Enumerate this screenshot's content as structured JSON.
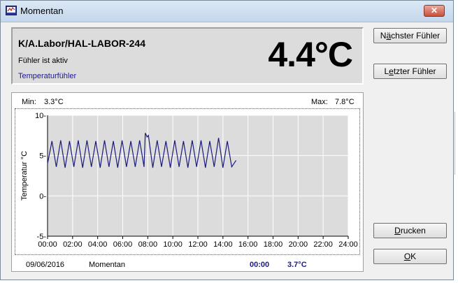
{
  "window": {
    "title": "Momentan",
    "close_glyph": "✕",
    "app_icon": "monitor-icon",
    "close_icon": "close-icon"
  },
  "header": {
    "sensor_name": "K/A.Labor/HAL-LABOR-244",
    "status": "Fühler ist aktiv",
    "type": "Temperaturfühler",
    "current_value": "4.4°C"
  },
  "buttons": {
    "next": {
      "pre": "N",
      "ul": "ä",
      "post": "chster Fühler"
    },
    "last": {
      "pre": "L",
      "ul": "e",
      "post": "tzter Fühler"
    },
    "print": {
      "pre": "",
      "ul": "D",
      "post": "rucken"
    },
    "ok": {
      "pre": "",
      "ul": "O",
      "post": "K"
    }
  },
  "minmax": {
    "min_label": "Min:",
    "min_value": "3.3°C",
    "max_label": "Max:",
    "max_value": "7.8°C"
  },
  "footer": {
    "date": "09/06/2016",
    "mode": "Momentan",
    "time": "00:00",
    "value": "3.7°C"
  },
  "chart_data": {
    "type": "line",
    "title": "",
    "xlabel": "",
    "ylabel": "Temperatur °C",
    "xlim": [
      0,
      24
    ],
    "ylim": [
      -5,
      10
    ],
    "x_ticks": [
      "00:00",
      "02:00",
      "04:00",
      "06:00",
      "08:00",
      "10:00",
      "12:00",
      "14:00",
      "16:00",
      "18:00",
      "20:00",
      "22:00",
      "24:00"
    ],
    "y_ticks": [
      "10-",
      "5-",
      "0-",
      "-5-"
    ],
    "y_tick_values": [
      10,
      5,
      0,
      -5
    ],
    "grid": true,
    "series": [
      {
        "color": "#1a1a7a",
        "x": [
          0.0,
          0.35,
          0.7,
          1.05,
          1.4,
          1.75,
          2.1,
          2.45,
          2.8,
          3.15,
          3.5,
          3.85,
          4.2,
          4.55,
          4.9,
          5.25,
          5.6,
          5.95,
          6.3,
          6.65,
          7.0,
          7.35,
          7.7,
          7.8,
          7.95,
          8.05,
          8.4,
          8.75,
          9.1,
          9.45,
          9.8,
          10.15,
          10.5,
          10.85,
          11.2,
          11.55,
          11.9,
          12.25,
          12.6,
          12.95,
          13.3,
          13.65,
          14.0,
          14.35,
          14.7,
          15.05
        ],
        "y": [
          4.0,
          6.8,
          3.6,
          6.9,
          3.5,
          6.8,
          3.6,
          6.9,
          3.5,
          6.9,
          3.6,
          6.8,
          3.5,
          6.9,
          3.6,
          6.8,
          3.5,
          6.9,
          3.6,
          6.8,
          3.6,
          6.9,
          3.6,
          7.8,
          7.3,
          7.5,
          3.5,
          6.9,
          3.6,
          6.8,
          3.5,
          6.9,
          3.6,
          6.8,
          3.5,
          6.9,
          3.6,
          6.9,
          3.5,
          6.8,
          3.6,
          7.2,
          3.5,
          6.8,
          3.6,
          4.4
        ]
      }
    ]
  }
}
